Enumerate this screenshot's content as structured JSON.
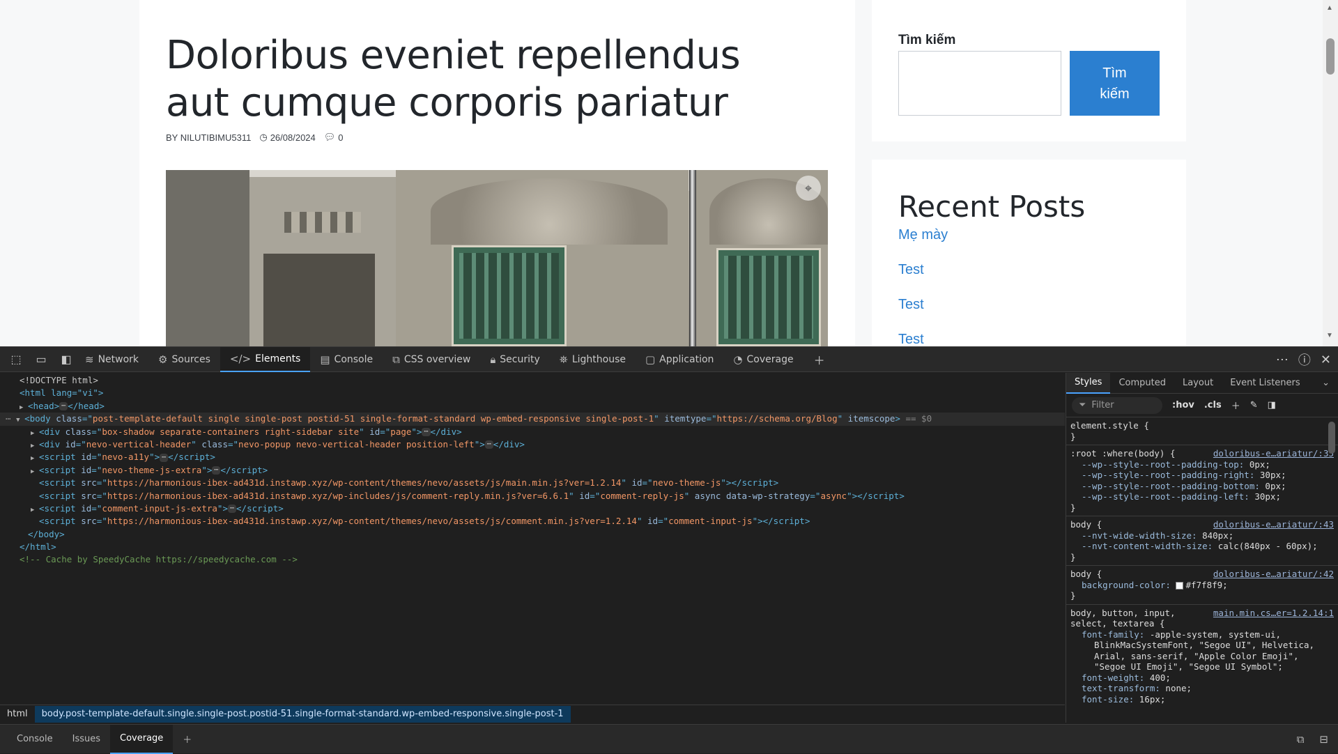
{
  "page": {
    "post_title": "Doloribus eveniet repellendus aut cumque corporis pariatur",
    "author": "BY NILUTIBIMU5311",
    "date": "26/08/2024",
    "comments": "0",
    "search_label": "Tìm kiếm",
    "search_button": "Tìm\nkiếm",
    "recent_posts_title": "Recent Posts",
    "recent_posts": [
      "Mẹ mày",
      "Test",
      "Test",
      "Test"
    ]
  },
  "devtools": {
    "tabs": [
      {
        "label": "Network",
        "icon": "wifi-icon"
      },
      {
        "label": "Sources",
        "icon": "gear-icon"
      },
      {
        "label": "Elements",
        "icon": "code-icon"
      },
      {
        "label": "Console",
        "icon": "console-icon"
      },
      {
        "label": "CSS overview",
        "icon": "css-overview-icon"
      },
      {
        "label": "Security",
        "icon": "lock-icon"
      },
      {
        "label": "Lighthouse",
        "icon": "lighthouse-icon"
      },
      {
        "label": "Application",
        "icon": "window-icon"
      },
      {
        "label": "Coverage",
        "icon": "coverage-icon"
      }
    ],
    "active_tab": "Elements",
    "dom": {
      "doctype": "<!DOCTYPE html>",
      "html_open": "<html lang=\"vi\">",
      "head": "<head>",
      "head_close": "</head>",
      "body_class": "post-template-default single single-post postid-51 single-format-standard wp-embed-responsive single-post-1",
      "body_itemtype": "https://schema.org/Blog",
      "div_page_class": "box-shadow separate-containers right-sidebar site",
      "div_page_id": "page",
      "div_header_id": "nevo-vertical-header",
      "div_header_class": "nevo-popup nevo-vertical-header position-left",
      "script_a11y_id": "nevo-a11y",
      "script_extra_id": "nevo-theme-js-extra",
      "script_main_src": "https://harmonious-ibex-ad431d.instawp.xyz/wp-content/themes/nevo/assets/js/main.min.js?ver=1.2.14",
      "script_main_id": "nevo-theme-js",
      "script_reply_src": "https://harmonious-ibex-ad431d.instawp.xyz/wp-includes/js/comment-reply.min.js?ver=6.6.1",
      "script_reply_id": "comment-reply-js",
      "script_reply_strategy": "async",
      "script_comment_extra_id": "comment-input-js-extra",
      "script_comment_src": "https://harmonious-ibex-ad431d.instawp.xyz/wp-content/themes/nevo/assets/js/comment.min.js?ver=1.2.14",
      "script_comment_id": "comment-input-js",
      "body_close": "</body>",
      "html_close": "</html>",
      "comment": "<!-- Cache by SpeedyCache https://speedycache.com -->"
    },
    "breadcrumbs": [
      "html",
      "body.post-template-default.single.single-post.postid-51.single-format-standard.wp-embed-responsive.single-post-1"
    ],
    "styles_tabs": [
      "Styles",
      "Computed",
      "Layout",
      "Event Listeners"
    ],
    "filter_placeholder": "Filter",
    "hov": ":hov",
    "cls": ".cls",
    "rules": {
      "element_style": "element.style {",
      "root_selector": ":root :where(body) {",
      "root_src": "doloribus-e…ariatur/:35",
      "root_props": [
        [
          "--wp--style--root--padding-top",
          "0px;"
        ],
        [
          "--wp--style--root--padding-right",
          "30px;"
        ],
        [
          "--wp--style--root--padding-bottom",
          "0px;"
        ],
        [
          "--wp--style--root--padding-left",
          "30px;"
        ]
      ],
      "body1_selector": "body {",
      "body1_src": "doloribus-e…ariatur/:43",
      "body1_props": [
        [
          "--nvt-wide-width-size",
          "840px;"
        ],
        [
          "--nvt-content-width-size",
          "calc(840px - 60px);"
        ]
      ],
      "body2_selector": "body {",
      "body2_src": "doloribus-e…ariatur/:42",
      "body2_prop": "background-color",
      "body2_val": "#f7f8f9;",
      "body3_selector_a": "body, button, input,",
      "body3_selector_b": "select, textarea {",
      "body3_src": "main.min.cs…er=1.2.14:1",
      "ff_prop": "font-family",
      "ff_val_1": "-apple-system, system-ui,",
      "ff_val_2": "BlinkMacSystemFont, \"Segoe UI\", Helvetica,",
      "ff_val_3": "Arial, sans-serif, \"Apple Color Emoji\",",
      "ff_val_4": "\"Segoe UI Emoji\", \"Segoe UI Symbol\";",
      "fw_prop": "font-weight",
      "fw_val": "400;",
      "tt_prop": "text-transform",
      "tt_val": "none;",
      "fs_prop": "font-size",
      "fs_val": "16px;"
    },
    "drawer_tabs": [
      "Console",
      "Issues",
      "Coverage"
    ],
    "drawer_active": "Coverage"
  }
}
